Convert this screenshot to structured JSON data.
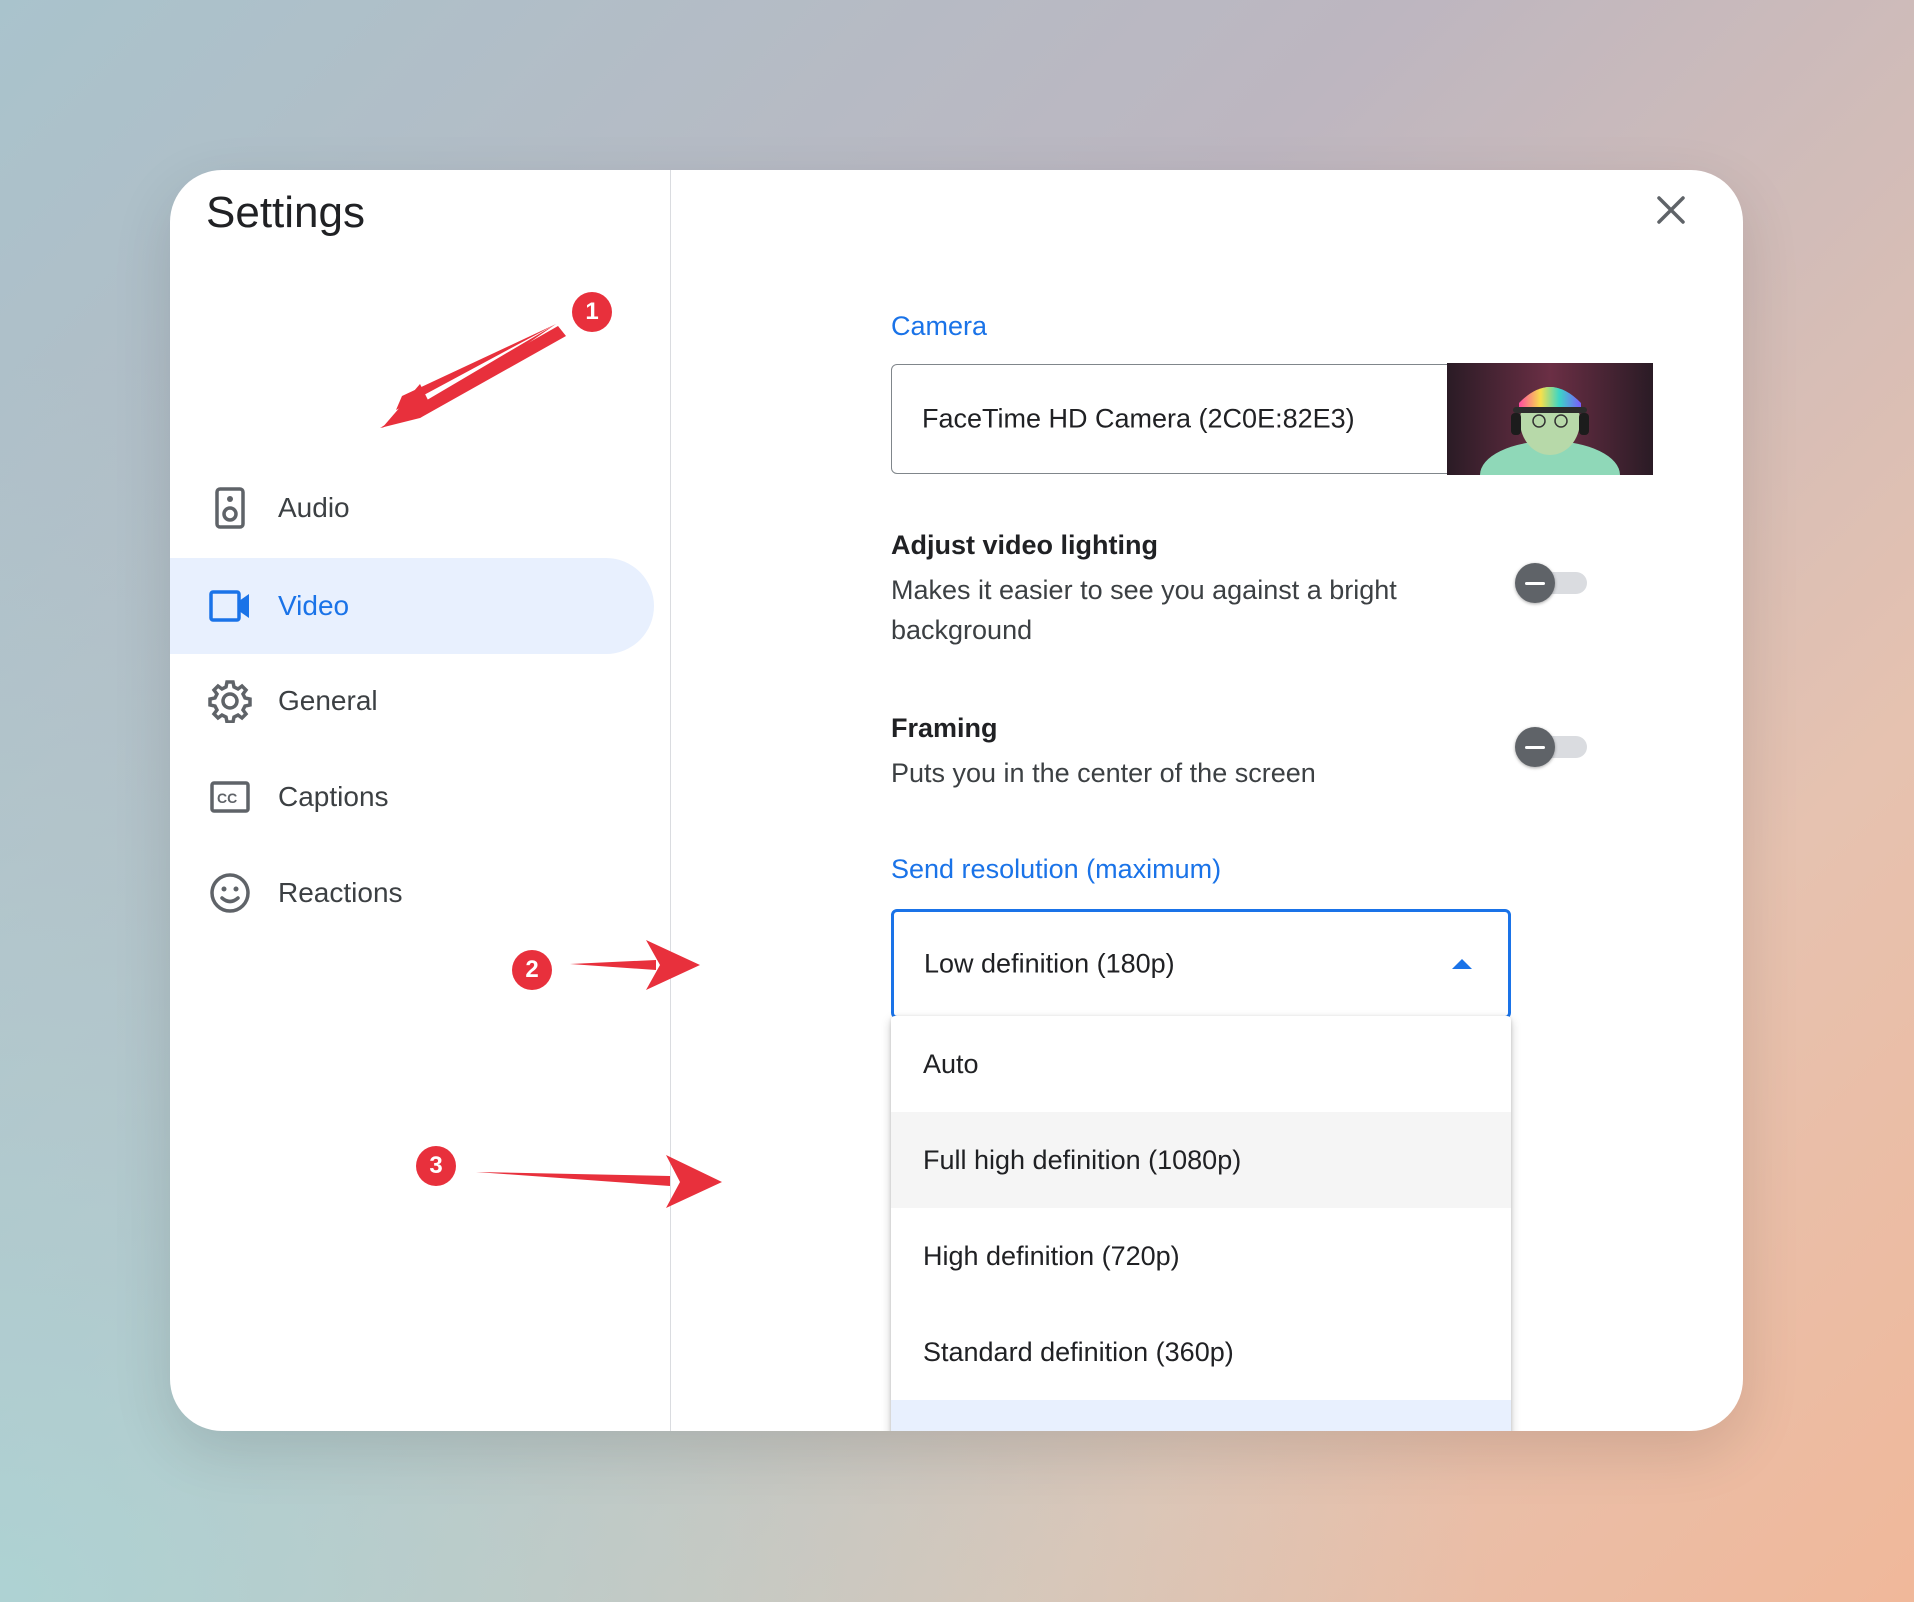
{
  "dialog": {
    "title": "Settings",
    "close_icon": "close-icon"
  },
  "sidebar": {
    "items": [
      {
        "label": "Audio",
        "icon": "speaker-icon",
        "active": false
      },
      {
        "label": "Video",
        "icon": "video-camera-icon",
        "active": true
      },
      {
        "label": "General",
        "icon": "gear-icon",
        "active": false
      },
      {
        "label": "Captions",
        "icon": "closed-captions-icon",
        "active": false
      },
      {
        "label": "Reactions",
        "icon": "smiley-icon",
        "active": false
      }
    ]
  },
  "main": {
    "camera": {
      "label": "Camera",
      "value": "FaceTime HD Camera (2C0E:82E3)",
      "preview_icon": "camera-preview-image"
    },
    "lighting": {
      "title": "Adjust video lighting",
      "description": "Makes it easier to see you against a bright background",
      "enabled": false
    },
    "framing": {
      "title": "Framing",
      "description": "Puts you in the center of the screen",
      "enabled": false
    },
    "resolution": {
      "label": "Send resolution (maximum)",
      "value": "Low definition (180p)",
      "options": [
        "Auto",
        "Full high definition (1080p)",
        "High definition (720p)",
        "Standard definition (360p)"
      ]
    }
  },
  "annotations": {
    "badges": [
      "1",
      "2",
      "3"
    ],
    "color": "#e8303c"
  },
  "colors": {
    "accent": "#1a73e8",
    "active_nav_bg": "#e8f0fe"
  }
}
